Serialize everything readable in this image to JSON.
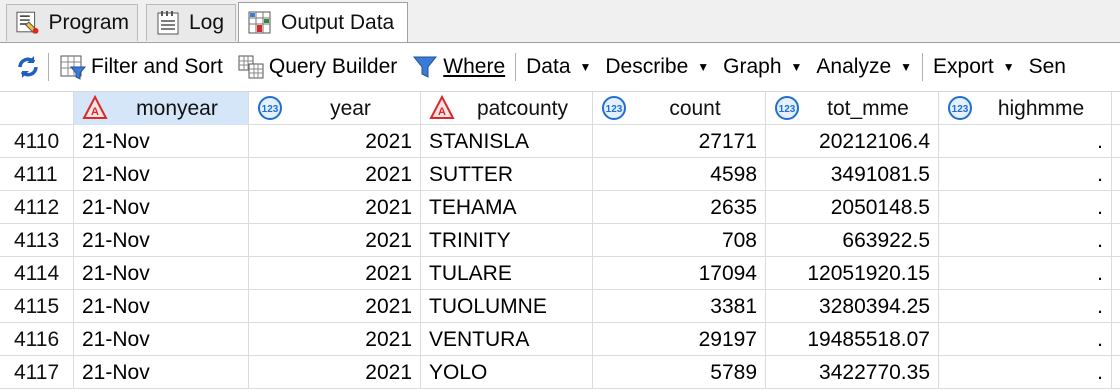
{
  "tabs": [
    {
      "label": "Program",
      "icon": "program-icon"
    },
    {
      "label": "Log",
      "icon": "log-icon"
    },
    {
      "label": "Output Data",
      "icon": "output-data-icon",
      "active": true
    }
  ],
  "toolbar": {
    "filter_sort": "Filter and Sort",
    "query_builder": "Query Builder",
    "where": "Where",
    "data": "Data",
    "describe": "Describe",
    "graph": "Graph",
    "analyze": "Analyze",
    "export": "Export",
    "send": "Sen"
  },
  "columns": [
    {
      "name": "monyear",
      "type": "character"
    },
    {
      "name": "year",
      "type": "numeric"
    },
    {
      "name": "patcounty",
      "type": "character"
    },
    {
      "name": "count",
      "type": "numeric"
    },
    {
      "name": "tot_mme",
      "type": "numeric"
    },
    {
      "name": "highmme",
      "type": "numeric"
    }
  ],
  "rows": [
    {
      "n": "4110",
      "monyear": "21-Nov",
      "year": "2021",
      "patcounty": "STANISLA",
      "count": "27171",
      "tot_mme": "20212106.4",
      "highmme": "."
    },
    {
      "n": "4111",
      "monyear": "21-Nov",
      "year": "2021",
      "patcounty": "SUTTER",
      "count": "4598",
      "tot_mme": "3491081.5",
      "highmme": "."
    },
    {
      "n": "4112",
      "monyear": "21-Nov",
      "year": "2021",
      "patcounty": "TEHAMA",
      "count": "2635",
      "tot_mme": "2050148.5",
      "highmme": "."
    },
    {
      "n": "4113",
      "monyear": "21-Nov",
      "year": "2021",
      "patcounty": "TRINITY",
      "count": "708",
      "tot_mme": "663922.5",
      "highmme": "."
    },
    {
      "n": "4114",
      "monyear": "21-Nov",
      "year": "2021",
      "patcounty": "TULARE",
      "count": "17094",
      "tot_mme": "12051920.15",
      "highmme": "."
    },
    {
      "n": "4115",
      "monyear": "21-Nov",
      "year": "2021",
      "patcounty": "TUOLUMNE",
      "count": "3381",
      "tot_mme": "3280394.25",
      "highmme": "."
    },
    {
      "n": "4116",
      "monyear": "21-Nov",
      "year": "2021",
      "patcounty": "VENTURA",
      "count": "29197",
      "tot_mme": "19485518.07",
      "highmme": "."
    },
    {
      "n": "4117",
      "monyear": "21-Nov",
      "year": "2021",
      "patcounty": "YOLO",
      "count": "5789",
      "tot_mme": "3422770.35",
      "highmme": "."
    }
  ],
  "colors": {
    "selected_header": "#d4e6f7",
    "numeric_icon": "#1f6fd1",
    "character_icon": "#d9292b"
  }
}
